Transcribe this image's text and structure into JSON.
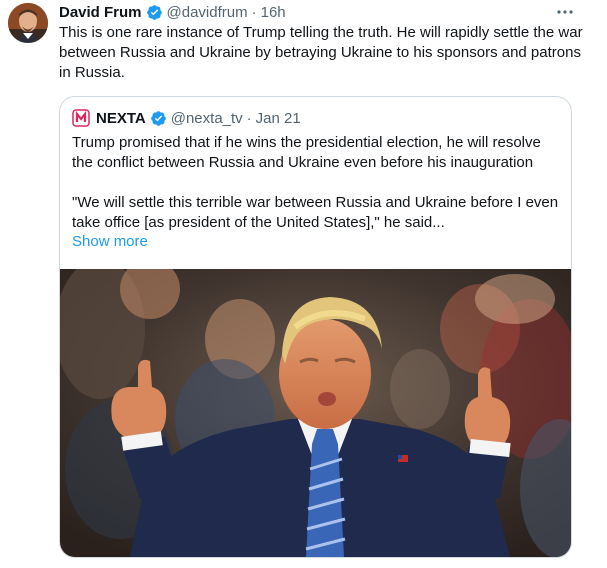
{
  "tweet": {
    "display_name": "David Frum",
    "handle": "@davidfrum",
    "separator": "·",
    "time": "16h",
    "text": "This is one rare instance of Trump telling the truth. He will rapidly settle the war between Russia and Ukraine by betraying Ukraine to his sponsors and patrons in Russia.",
    "icons": {
      "verified": "verified-badge-icon",
      "more": "more-options-icon"
    },
    "colors": {
      "verified": "#1d9bf0",
      "secondary_text": "#536471"
    }
  },
  "quote": {
    "display_name": "NEXTA",
    "handle": "@nexta_tv",
    "separator": "·",
    "time": "Jan 21",
    "paragraph_1": "Trump promised that if he wins the presidential election, he will resolve the conflict between Russia and Ukraine even before his inauguration",
    "paragraph_2": "\"We will settle this terrible war between Russia and Ukraine before I even take office [as president of the United States],\" he said...",
    "show_more": "Show more",
    "colors": {
      "link": "#1d9bf0",
      "brand": "#e0245e"
    }
  }
}
